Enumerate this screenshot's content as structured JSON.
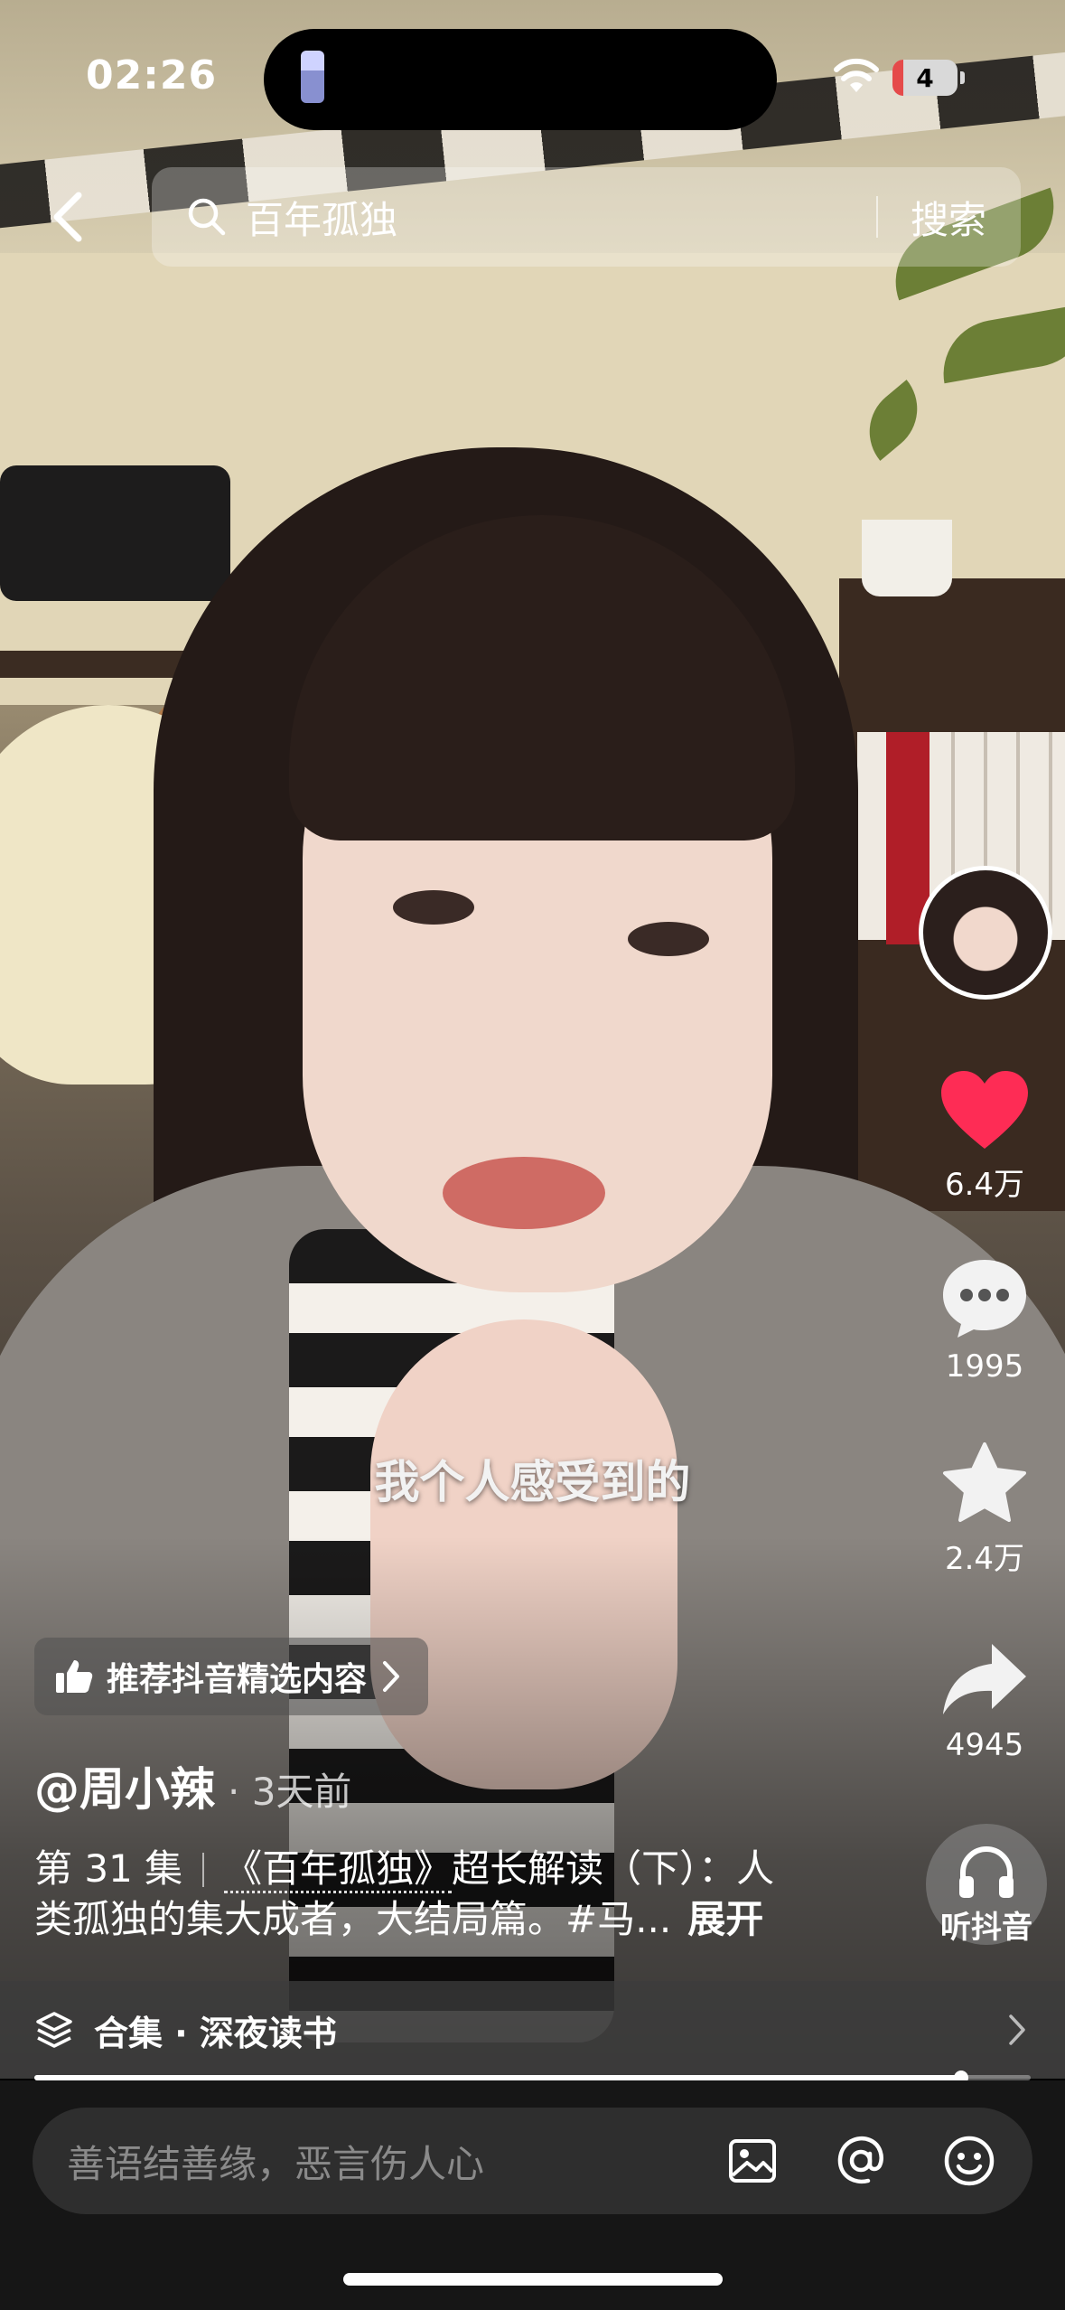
{
  "status_bar": {
    "time": "02:26",
    "battery": "4"
  },
  "search": {
    "query": "百年孤独",
    "button": "搜索"
  },
  "actions": {
    "likes": "6.4万",
    "comments": "1995",
    "favorites": "2.4万",
    "shares": "4945",
    "listen": "听抖音"
  },
  "video": {
    "subtitle": "我个人感受到的",
    "recommend": "推荐抖音精选内容",
    "author": "@周小辣",
    "time_ago": "· 3天前",
    "caption": {
      "episode": "第 31 集",
      "book": "《百年孤独》",
      "text_line1_rest": "超长解读（下）：人",
      "text_line2": "类孤独的集大成者，大结局篇。#马...",
      "expand": "展开"
    },
    "collection": "合集 · 深夜读书",
    "progress": 0.93
  },
  "comment_bar": {
    "placeholder": "善语结善缘，恶言伤人心"
  },
  "colors": {
    "like": "#fe2c55",
    "bar_bg": "#161616",
    "input_bg": "#2e2e2e"
  },
  "icons": [
    "back-icon",
    "search-icon",
    "heart-icon",
    "comment-icon",
    "star-icon",
    "share-icon",
    "headphones-icon",
    "thumbs-up-icon",
    "layers-icon",
    "image-icon",
    "at-icon",
    "emoji-icon",
    "wifi-icon"
  ]
}
